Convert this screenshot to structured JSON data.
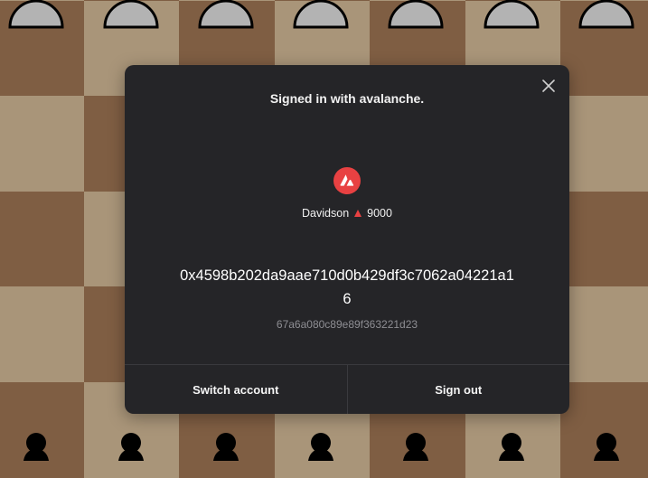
{
  "board": {
    "light_color": "#a99579",
    "dark_color": "#7f5e43",
    "top_pieces": "pawn-half-icon",
    "bottom_pieces": "pawn-icon"
  },
  "modal": {
    "title": "Signed in with avalanche.",
    "close_icon": "close-icon",
    "avatar_icon": "avalanche-logo-icon",
    "username": "Davidson",
    "rating_icon": "red-triangle-icon",
    "rating": "9000",
    "address": "0x4598b202da9aae710d0b429df3c7062a04221a16",
    "subhash": "67a6a080c89e89f363221d23",
    "accent_color": "#e84142",
    "switch_label": "Switch account",
    "signout_label": "Sign out"
  }
}
